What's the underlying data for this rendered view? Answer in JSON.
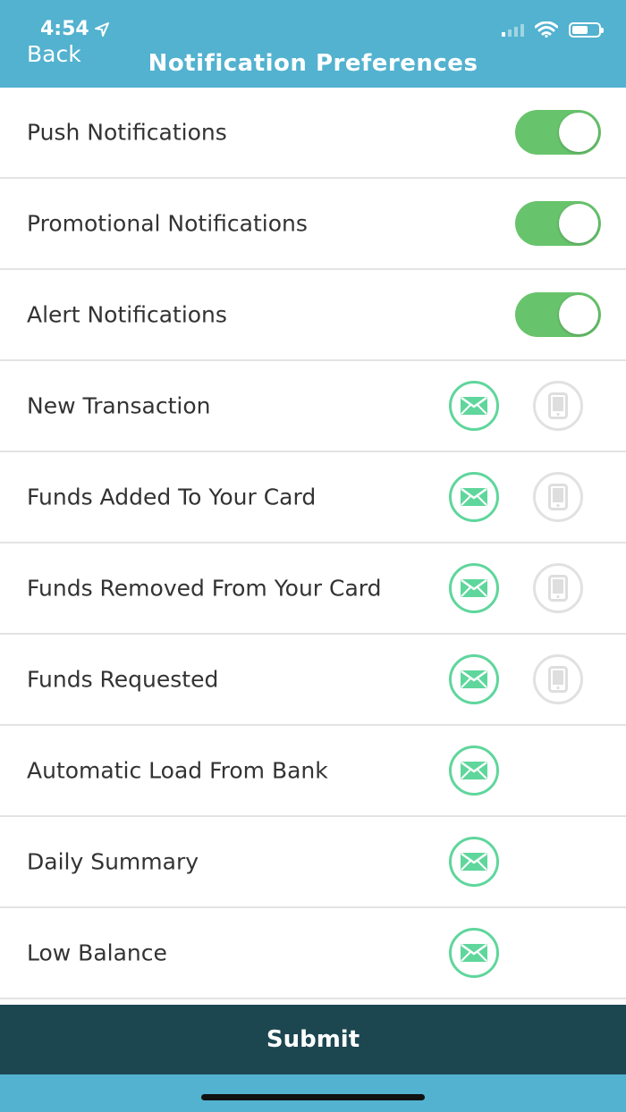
{
  "status_bar": {
    "time": "4:54"
  },
  "header": {
    "back_label": "Back",
    "title": "Notification Preferences"
  },
  "toggles": [
    {
      "label": "Push Notifications",
      "on": true
    },
    {
      "label": "Promotional Notifications",
      "on": true
    },
    {
      "label": "Alert Notifications",
      "on": true
    }
  ],
  "preferences": [
    {
      "label": "New Transaction",
      "email": true,
      "phone": true
    },
    {
      "label": "Funds Added To Your Card",
      "email": true,
      "phone": true
    },
    {
      "label": "Funds Removed From Your Card",
      "email": true,
      "phone": true
    },
    {
      "label": "Funds Requested",
      "email": true,
      "phone": true
    },
    {
      "label": "Automatic Load From Bank",
      "email": true,
      "phone": false
    },
    {
      "label": "Daily Summary",
      "email": true,
      "phone": false
    },
    {
      "label": "Low Balance",
      "email": true,
      "phone": false
    }
  ],
  "submit_label": "Submit",
  "colors": {
    "header": "#52b2cf",
    "toggle_on": "#68c46c",
    "email_accent": "#5fd69c",
    "phone_inactive": "#e1e1e1",
    "submit_bg": "#1c4650"
  },
  "icons": {
    "location": "location-arrow-icon",
    "signal": "cellular-signal-icon",
    "wifi": "wifi-icon",
    "battery": "battery-icon",
    "email": "envelope-icon",
    "phone": "mobile-phone-icon"
  }
}
